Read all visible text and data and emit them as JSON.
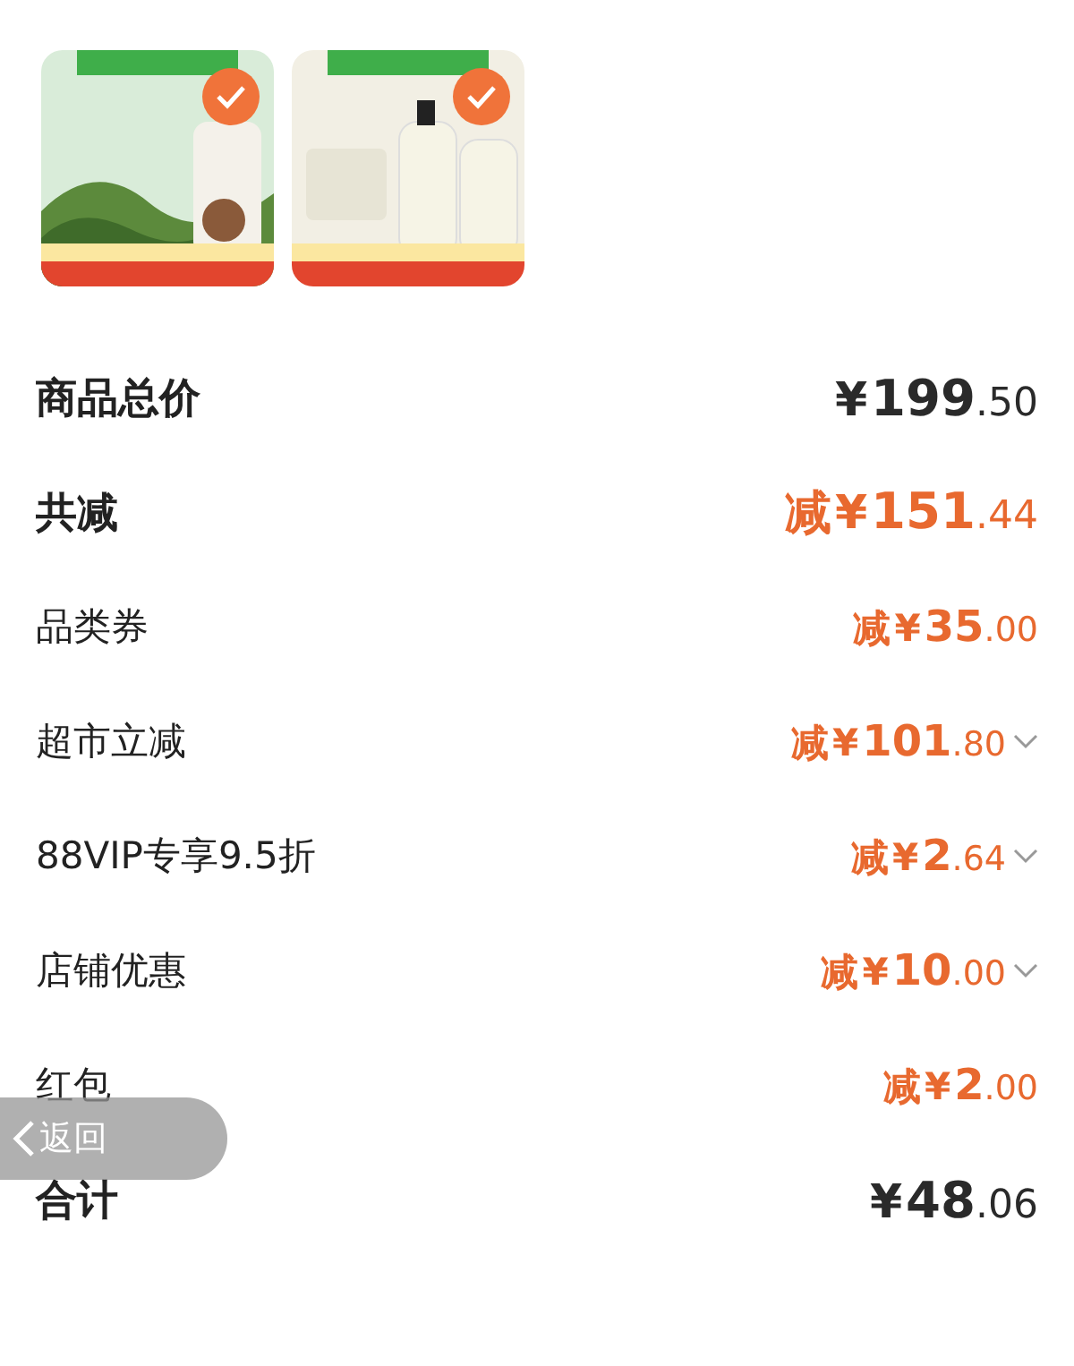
{
  "products": [
    {
      "kind": "picture",
      "selected": true
    },
    {
      "kind": "picture",
      "selected": true
    }
  ],
  "rows": [
    {
      "kind": "total",
      "label": "商品总价",
      "prefix": "",
      "currency": "¥",
      "amount": "199.50",
      "accent": false,
      "expandable": false
    },
    {
      "kind": "total",
      "label": "共减",
      "prefix": "减",
      "currency": "¥",
      "amount": "151.44",
      "accent": true,
      "expandable": false
    },
    {
      "kind": "item",
      "label": "品类券",
      "prefix": "减",
      "currency": "¥",
      "amount": "35.00",
      "accent": true,
      "expandable": false
    },
    {
      "kind": "item",
      "label": "超市立减",
      "prefix": "减",
      "currency": "¥",
      "amount": "101.80",
      "accent": true,
      "expandable": true
    },
    {
      "kind": "item",
      "label": "88VIP专享9.5折",
      "prefix": "减",
      "currency": "¥",
      "amount": "2.64",
      "accent": true,
      "expandable": true
    },
    {
      "kind": "item",
      "label": "店铺优惠",
      "prefix": "减",
      "currency": "¥",
      "amount": "10.00",
      "accent": true,
      "expandable": true
    },
    {
      "kind": "item",
      "label": "红包",
      "prefix": "减",
      "currency": "¥",
      "amount": "2.00",
      "accent": true,
      "expandable": false
    },
    {
      "kind": "total",
      "label": "合计",
      "prefix": "",
      "currency": "¥",
      "amount": "48.06",
      "accent": false,
      "expandable": false
    }
  ],
  "back_button": {
    "label": "返回"
  }
}
